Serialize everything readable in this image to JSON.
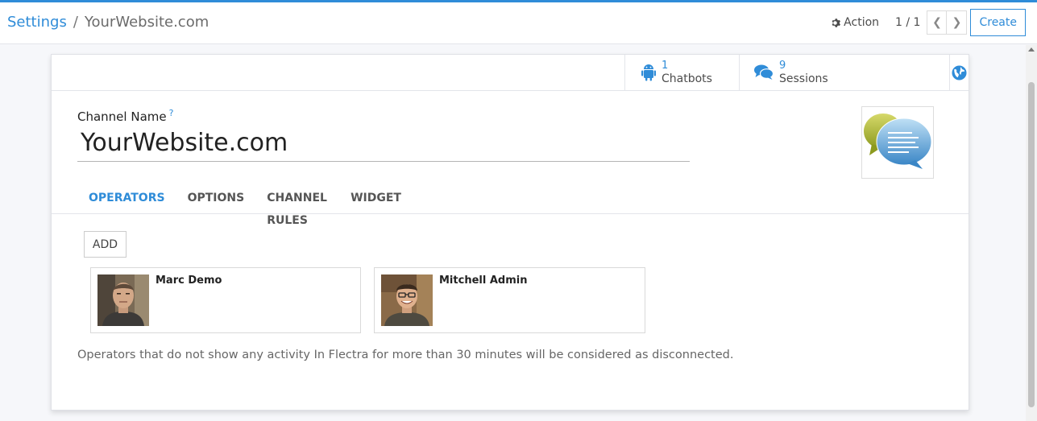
{
  "breadcrumb": {
    "parent": "Settings",
    "separator": "/",
    "current": "YourWebsite.com"
  },
  "control_panel": {
    "action_label": "Action",
    "pager_value": "1 / 1",
    "create_label": "Create"
  },
  "stats": [
    {
      "value": "1",
      "label": "Chatbots",
      "icon": "android-icon"
    },
    {
      "value": "9",
      "label": "Sessions",
      "icon": "comments-icon"
    }
  ],
  "form": {
    "channel_name_label": "Channel Name",
    "help_marker": "?",
    "channel_name_value": "YourWebsite.com"
  },
  "tabs": [
    "OPERATORS",
    "OPTIONS",
    "CHANNEL RULES",
    "WIDGET"
  ],
  "operators": {
    "add_label": "ADD",
    "items": [
      {
        "name": "Marc Demo"
      },
      {
        "name": "Mitchell Admin"
      }
    ],
    "hint": "Operators that do not show any activity In Flectra for more than 30 minutes will be considered as disconnected."
  },
  "colors": {
    "accent": "#2f8cd8",
    "text": "#4c4c4c"
  }
}
